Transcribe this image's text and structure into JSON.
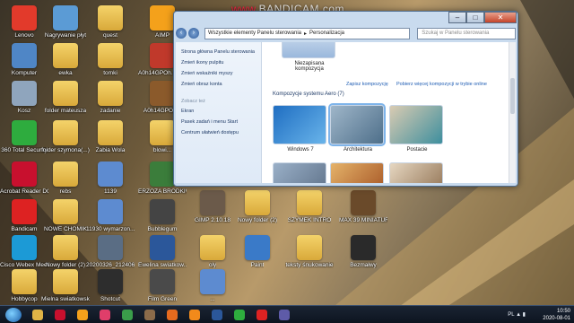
{
  "watermark": {
    "text": "BANDICAM",
    "rec_prefix": "www.",
    "domain_suffix": ".com"
  },
  "desktop_icons": [
    {
      "label": "Lenovo",
      "icon": "lenovo-icon",
      "color": "#e23a2b"
    },
    {
      "label": "Nagrywanie płyt",
      "icon": "disc-burn-icon",
      "color": "#5b9bd5"
    },
    {
      "label": "quest",
      "icon": "folder-icon",
      "color": "#e0b446"
    },
    {
      "label": "AIMP",
      "icon": "aimp-icon",
      "color": "#f4a11b"
    },
    {
      "label": "Komputer",
      "icon": "computer-icon",
      "color": "#4f86c6"
    },
    {
      "label": "ewka",
      "icon": "folder-icon",
      "color": "#e0b446"
    },
    {
      "label": "tomki",
      "icon": "folder-icon",
      "color": "#e0b446"
    },
    {
      "label": "A0h14GPOh... (obraz JPEG)",
      "icon": "image-icon",
      "color": "#c0392b"
    },
    {
      "label": "Kosz",
      "icon": "recycle-bin-icon",
      "color": "#8fa5bd"
    },
    {
      "label": "folder mateusza",
      "icon": "folder-icon",
      "color": "#e0b446"
    },
    {
      "label": "zadanie",
      "icon": "folder-icon",
      "color": "#e0b446"
    },
    {
      "label": "A0h14GPOh...",
      "icon": "image-icon",
      "color": "#8b5a2b"
    },
    {
      "label": "360 Total Security",
      "icon": "shield-icon",
      "color": "#2eac3e"
    },
    {
      "label": "folder szymona(...)",
      "icon": "folder-icon",
      "color": "#e0b446"
    },
    {
      "label": "Zabia Wola",
      "icon": "folder-icon",
      "color": "#e0b446"
    },
    {
      "label": "blowi...",
      "icon": "folder-icon",
      "color": "#e0b446"
    },
    {
      "label": "Acrobat Reader DC",
      "icon": "acrobat-icon",
      "color": "#c8102e"
    },
    {
      "label": "rebs",
      "icon": "folder-icon",
      "color": "#e0b446"
    },
    {
      "label": "1139",
      "icon": "mp3-icon",
      "color": "#5d8bd0"
    },
    {
      "label": "ERZOZA BRODKIWKOWATA",
      "icon": "image-icon",
      "color": "#3b7d3b"
    },
    {
      "label": "Bandicam",
      "icon": "bandicam-icon",
      "color": "#d22"
    },
    {
      "label": "NOWE CHOMIK",
      "icon": "folder-icon",
      "color": "#e0b446"
    },
    {
      "label": "11930 wymarzon...",
      "icon": "mp3-icon",
      "color": "#5d8bd0"
    },
    {
      "label": "Bubblegum",
      "icon": "abc-icon",
      "color": "#444"
    },
    {
      "label": "Cisco Webex Meetings",
      "icon": "webex-icon",
      "color": "#1c9ad6"
    },
    {
      "label": "Nowy folder (2)",
      "icon": "folder-icon",
      "color": "#e0b446"
    },
    {
      "label": "20200326_212406",
      "icon": "image-icon",
      "color": "#5a6d84"
    },
    {
      "label": "Ewelina swiatkow...",
      "icon": "word-icon",
      "color": "#2b579a"
    },
    {
      "label": "Hobbycop",
      "icon": "folder-icon",
      "color": "#e0b446"
    },
    {
      "label": "Mielna swiatkowska... Zdjęcia",
      "icon": "folder-icon",
      "color": "#e0b446"
    },
    {
      "label": "Shotcut",
      "icon": "shotcut-icon",
      "color": "#2d2d2d"
    },
    {
      "label": "Film Green",
      "icon": "film-icon",
      "color": "#4a4a4a"
    },
    {
      "label": "GIMP 2.10.18",
      "icon": "gimp-icon",
      "color": "#6b5a4a"
    },
    {
      "label": "Nowy folder (2)",
      "icon": "folder-icon",
      "color": "#e0b446"
    },
    {
      "label": "SZYMEK INTRO",
      "icon": "folder-icon",
      "color": "#e0b446"
    },
    {
      "label": "MAX 39 MINIATURE...",
      "icon": "image-icon",
      "color": "#6a4a2a"
    },
    {
      "label": "oly",
      "icon": "folder-icon",
      "color": "#e0b446"
    },
    {
      "label": "Paint",
      "icon": "paint-icon",
      "color": "#3a7ac8"
    },
    {
      "label": "teksty śnukowanie",
      "icon": "folder-icon",
      "color": "#e0b446"
    },
    {
      "label": "Bezmałwy",
      "icon": "m-icon",
      "color": "#2a2a2a"
    },
    {
      "label": "...",
      "icon": "audio-icon",
      "color": "#5d8bd0"
    }
  ],
  "window": {
    "breadcrumb": [
      "Wszystkie elementy Panelu sterowania",
      "Personalizacja"
    ],
    "search_placeholder": "Szukaj w Panelu sterowania",
    "controls": {
      "min": "–",
      "max": "□",
      "close": "✕"
    },
    "left_links": [
      "Strona główna Panelu sterowania",
      "Zmień ikony pulpitu",
      "Zmień wskaźniki myszy",
      "Zmień obraz konta"
    ],
    "see_also_title": "Zobacz też",
    "see_also_links": [
      "Ekran",
      "Pasek zadań i menu Start",
      "Centrum ułatwień dostępu"
    ],
    "top_theme_label": "Niezapisana kompozycja",
    "save_link": "Zapisz kompozycję",
    "more_link": "Pobierz więcej kompozycji w trybie online",
    "group_title": "Kompozycje systemu Aero (7)",
    "themes": [
      {
        "name": "Windows 7",
        "colors": [
          "#1f6ec2",
          "#69b4ea"
        ]
      },
      {
        "name": "Architektura",
        "colors": [
          "#9fb6c9",
          "#4e6f8a"
        ]
      },
      {
        "name": "Postacie",
        "colors": [
          "#d9cbb2",
          "#3e8f9e"
        ]
      }
    ],
    "themes_row2": [
      {
        "colors": [
          "#9ab0c8",
          "#5a6d84"
        ]
      },
      {
        "colors": [
          "#e5b36a",
          "#a04d1f"
        ]
      },
      {
        "colors": [
          "#e6d7c1",
          "#8a6a4a"
        ]
      }
    ]
  },
  "taskbar": {
    "items": [
      {
        "icon": "explorer-icon",
        "color": "#e0b446"
      },
      {
        "icon": "acrobat-icon",
        "color": "#c8102e"
      },
      {
        "icon": "aimp-icon",
        "color": "#f4a11b"
      },
      {
        "icon": "bubble-icon",
        "color": "#e03e6a"
      },
      {
        "icon": "chrome-icon",
        "color": "#3a9d4a"
      },
      {
        "icon": "gimp-icon",
        "color": "#8b6b4a"
      },
      {
        "icon": "firefox-icon",
        "color": "#e66a1e"
      },
      {
        "icon": "vlc-icon",
        "color": "#f28a1b"
      },
      {
        "icon": "word-icon",
        "color": "#2b579a"
      },
      {
        "icon": "360-icon",
        "color": "#2eac3e"
      },
      {
        "icon": "bandicam-icon",
        "color": "#d22"
      },
      {
        "icon": "teams-icon",
        "color": "#5e5ba8"
      }
    ],
    "language": "PL",
    "time": "10:50",
    "date": "2020-08-01"
  }
}
